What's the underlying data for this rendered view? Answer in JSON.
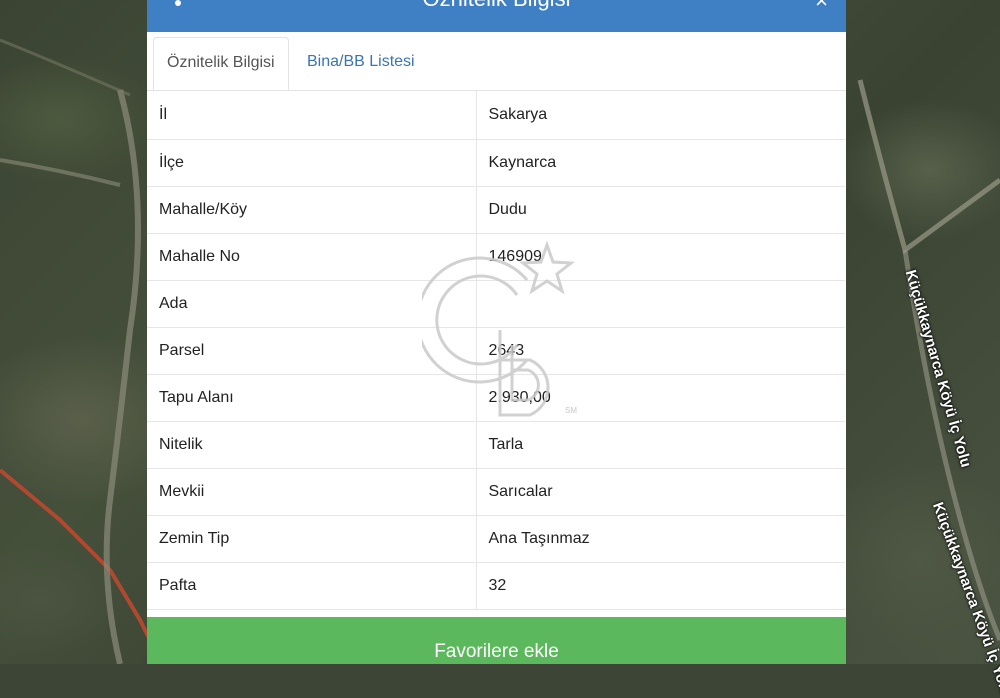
{
  "modal": {
    "title": "Öznitelik Bilgisi",
    "close_glyph": "×"
  },
  "tabs": [
    {
      "label": "Öznitelik Bilgisi",
      "active": true
    },
    {
      "label": "Bina/BB Listesi",
      "active": false
    }
  ],
  "attributes": [
    {
      "key": "İl",
      "value": "Sakarya"
    },
    {
      "key": "İlçe",
      "value": "Kaynarca"
    },
    {
      "key": "Mahalle/Köy",
      "value": "Dudu"
    },
    {
      "key": "Mahalle No",
      "value": "146909"
    },
    {
      "key": "Ada",
      "value": ""
    },
    {
      "key": "Parsel",
      "value": "2643"
    },
    {
      "key": "Tapu Alanı",
      "value": "2.930,00"
    },
    {
      "key": "Nitelik",
      "value": "Tarla"
    },
    {
      "key": "Mevkii",
      "value": "Sarıcalar"
    },
    {
      "key": "Zemin Tip",
      "value": "Ana Taşınmaz"
    },
    {
      "key": "Pafta",
      "value": "32"
    }
  ],
  "favorite_button": "Favorilere ekle",
  "map": {
    "road_label_1": "Küçükkaynarca Köyü İç Yolu",
    "road_label_2": "Küçükkaynarca Köyü İç Yolu"
  },
  "watermark": {
    "logo": "CB",
    "trademark": "SM"
  },
  "colors": {
    "header": "#3f7fc4",
    "tab_link": "#3a74b6",
    "favorite_button": "#5cb85c"
  }
}
